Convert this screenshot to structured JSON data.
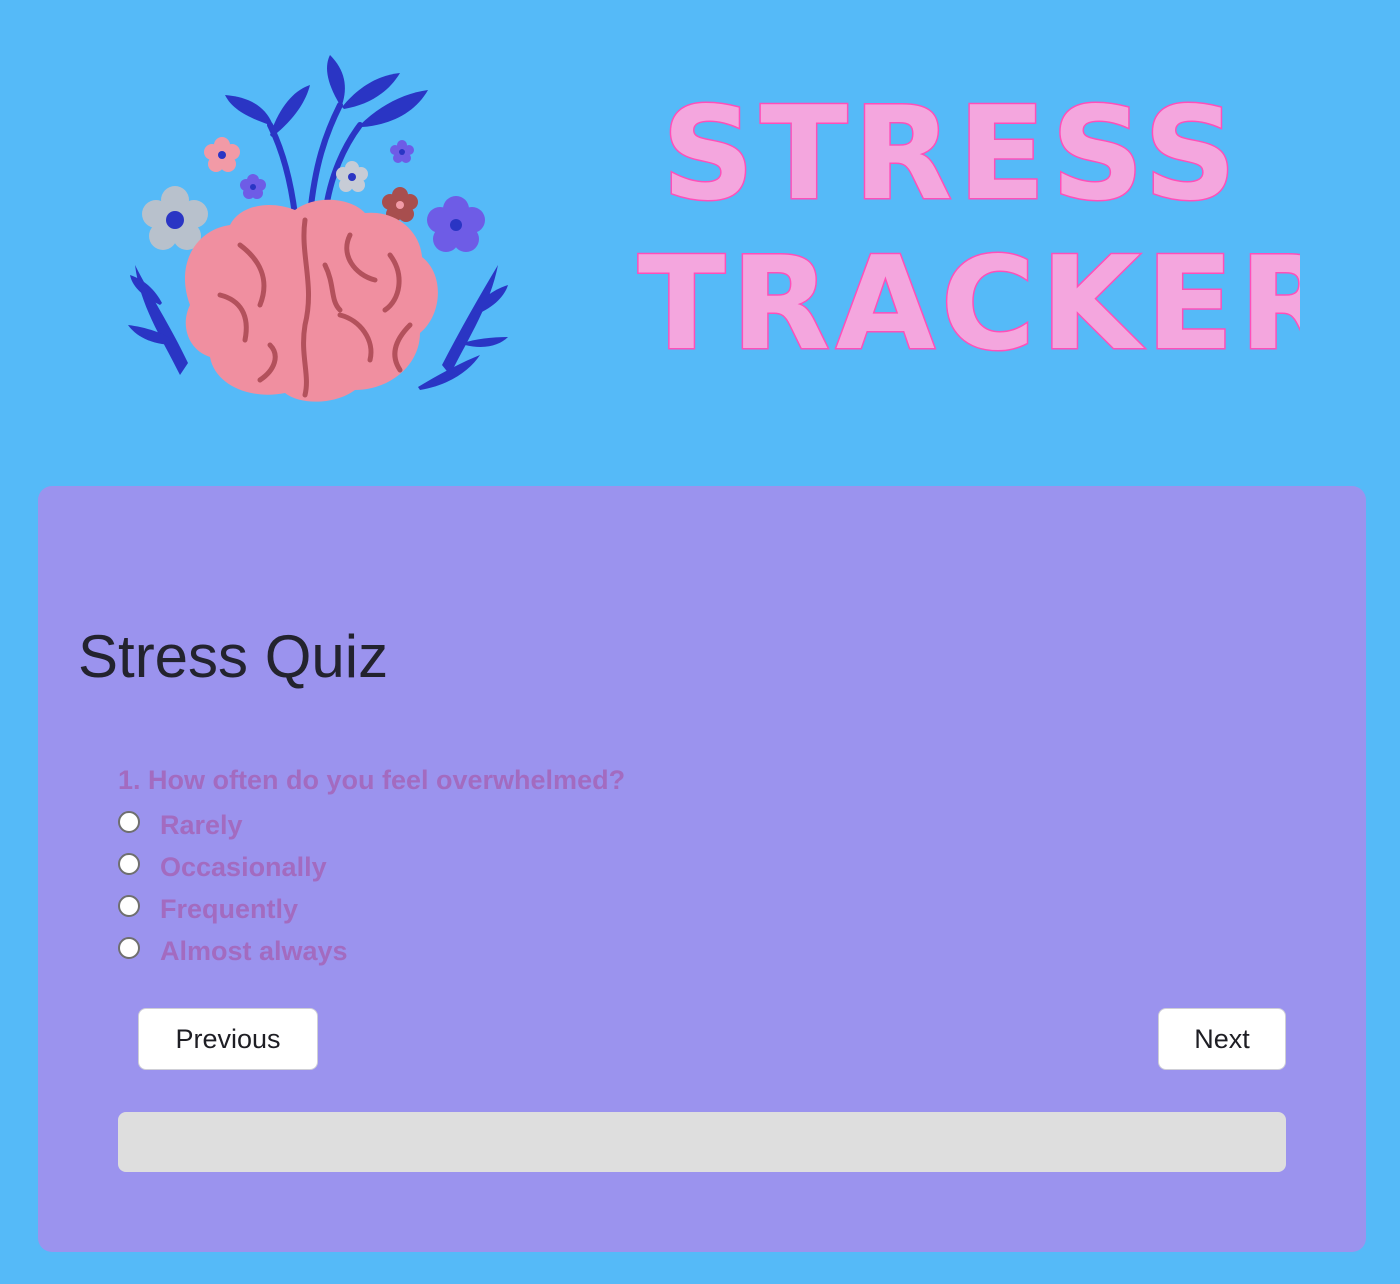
{
  "header": {
    "title_line1": "STRESS",
    "title_line2": "TRACKER"
  },
  "quiz": {
    "title": "Stress Quiz",
    "question": "1. How often do you feel overwhelmed?",
    "options": [
      "Rarely",
      "Occasionally",
      "Frequently",
      "Almost always"
    ],
    "selected_option": null,
    "previous_label": "Previous",
    "next_label": "Next",
    "progress_fraction": 0
  },
  "colors": {
    "page_background": "#55baf8",
    "card_background": "#9b93ee",
    "question_text": "#a36bc0",
    "title_fill": "#f4a6de",
    "title_outline": "#ff4fb9",
    "progress_track": "#dedede"
  },
  "icons": {
    "logo": "brain-with-sprouts-and-flowers-icon"
  }
}
